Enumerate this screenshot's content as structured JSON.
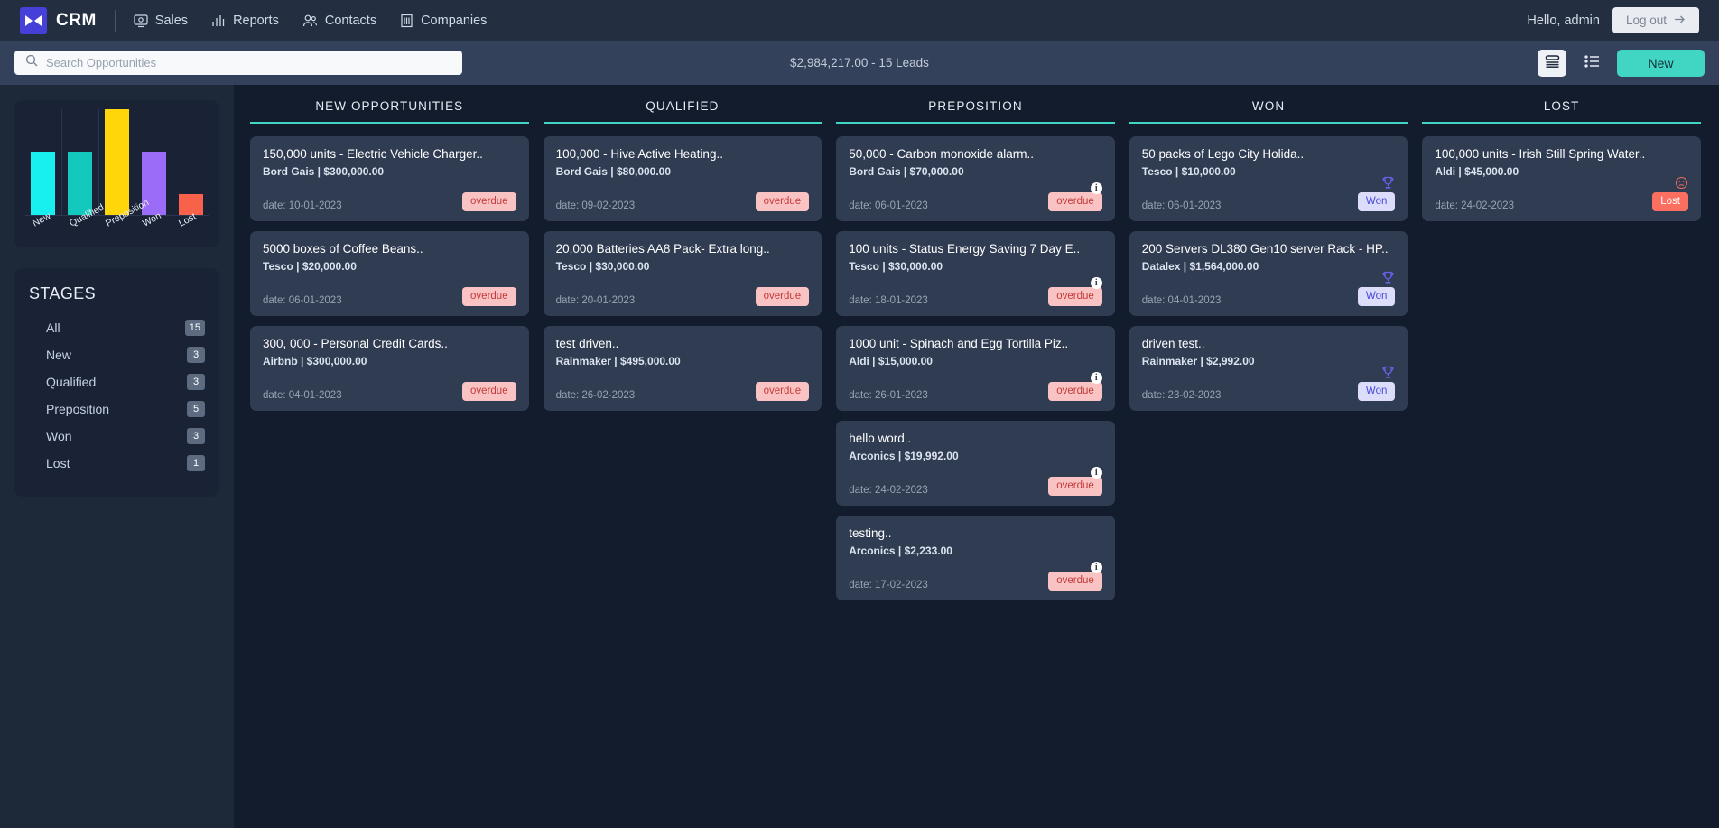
{
  "header": {
    "brand": "CRM",
    "logo_icon": "bowtie-logo-icon",
    "nav": [
      {
        "label": "Sales",
        "icon": "sales-screen-icon"
      },
      {
        "label": "Reports",
        "icon": "bar-chart-icon"
      },
      {
        "label": "Contacts",
        "icon": "people-icon"
      },
      {
        "label": "Companies",
        "icon": "building-icon"
      }
    ],
    "greeting": "Hello, admin",
    "logout_label": "Log out",
    "logout_icon": "arrow-right-icon"
  },
  "toolbar": {
    "search_placeholder": "Search Opportunities",
    "search_value": "",
    "search_icon": "search-icon",
    "stats": "$2,984,217.00 - 15 Leads",
    "board_view_icon": "board-view-icon",
    "list_view_icon": "list-view-icon",
    "new_label": "New"
  },
  "sidebar": {
    "stages_title": "STAGES",
    "stages": [
      {
        "label": "All",
        "count": "15"
      },
      {
        "label": "New",
        "count": "3"
      },
      {
        "label": "Qualified",
        "count": "3"
      },
      {
        "label": "Preposition",
        "count": "5"
      },
      {
        "label": "Won",
        "count": "3"
      },
      {
        "label": "Lost",
        "count": "1"
      }
    ]
  },
  "chart_data": {
    "type": "bar",
    "title": "",
    "xlabel": "",
    "ylabel": "",
    "categories": [
      "New",
      "Qualified",
      "Preposition",
      "Won",
      "Lost"
    ],
    "values": [
      3,
      3,
      5,
      3,
      1
    ],
    "colors": [
      "#18f0f0",
      "#13c9bd",
      "#ffd60a",
      "#9b6cf7",
      "#f9624a"
    ],
    "ylim": [
      0,
      5
    ],
    "grid": true,
    "legend": "none"
  },
  "board": {
    "columns": [
      {
        "title": "NEW OPPORTUNITIES",
        "cards": [
          {
            "title": "150,000 units - Electric Vehicle Charger..",
            "sub": "Bord Gais | $300,000.00",
            "date": "date: 10-01-2023",
            "badge": "overdue",
            "badge_type": "overdue",
            "mark": "none"
          },
          {
            "title": "5000 boxes of Coffee Beans..",
            "sub": "Tesco | $20,000.00",
            "date": "date: 06-01-2023",
            "badge": "overdue",
            "badge_type": "overdue",
            "mark": "none"
          },
          {
            "title": "300, 000 - Personal Credit Cards..",
            "sub": "Airbnb | $300,000.00",
            "date": "date: 04-01-2023",
            "badge": "overdue",
            "badge_type": "overdue",
            "mark": "none"
          }
        ]
      },
      {
        "title": "QUALIFIED",
        "cards": [
          {
            "title": "100,000 - Hive Active Heating..",
            "sub": "Bord Gais | $80,000.00",
            "date": "date: 09-02-2023",
            "badge": "overdue",
            "badge_type": "overdue",
            "mark": "none"
          },
          {
            "title": "20,000 Batteries AA8 Pack- Extra long..",
            "sub": "Tesco | $30,000.00",
            "date": "date: 20-01-2023",
            "badge": "overdue",
            "badge_type": "overdue",
            "mark": "none"
          },
          {
            "title": "test driven..",
            "sub": "Rainmaker | $495,000.00",
            "date": "date: 26-02-2023",
            "badge": "overdue",
            "badge_type": "overdue",
            "mark": "none"
          }
        ]
      },
      {
        "title": "PREPOSITION",
        "cards": [
          {
            "title": "50,000 - Carbon monoxide alarm..",
            "sub": "Bord Gais | $70,000.00",
            "date": "date: 06-01-2023",
            "badge": "overdue",
            "badge_type": "overdue",
            "mark": "info"
          },
          {
            "title": "100 units - Status Energy Saving 7 Day E..",
            "sub": "Tesco | $30,000.00",
            "date": "date: 18-01-2023",
            "badge": "overdue",
            "badge_type": "overdue",
            "mark": "info"
          },
          {
            "title": "1000 unit - Spinach and Egg Tortilla Piz..",
            "sub": "Aldi | $15,000.00",
            "date": "date: 26-01-2023",
            "badge": "overdue",
            "badge_type": "overdue",
            "mark": "info"
          },
          {
            "title": "hello word..",
            "sub": "Arconics | $19,992.00",
            "date": "date: 24-02-2023",
            "badge": "overdue",
            "badge_type": "overdue",
            "mark": "info"
          },
          {
            "title": "testing..",
            "sub": "Arconics | $2,233.00",
            "date": "date: 17-02-2023",
            "badge": "overdue",
            "badge_type": "overdue",
            "mark": "info"
          }
        ]
      },
      {
        "title": "WON",
        "cards": [
          {
            "title": "50 packs of Lego City Holida..",
            "sub": "Tesco | $10,000.00",
            "date": "date: 06-01-2023",
            "badge": "Won",
            "badge_type": "won",
            "mark": "trophy"
          },
          {
            "title": "200 Servers DL380 Gen10 server Rack - HP..",
            "sub": "Datalex | $1,564,000.00",
            "date": "date: 04-01-2023",
            "badge": "Won",
            "badge_type": "won",
            "mark": "trophy"
          },
          {
            "title": "driven test..",
            "sub": "Rainmaker | $2,992.00",
            "date": "date: 23-02-2023",
            "badge": "Won",
            "badge_type": "won",
            "mark": "trophy"
          }
        ]
      },
      {
        "title": "LOST",
        "cards": [
          {
            "title": "100,000 units - Irish Still Spring Water..",
            "sub": "Aldi | $45,000.00",
            "date": "date: 24-02-2023",
            "badge": "Lost",
            "badge_type": "lost",
            "mark": "sad"
          }
        ]
      }
    ]
  }
}
